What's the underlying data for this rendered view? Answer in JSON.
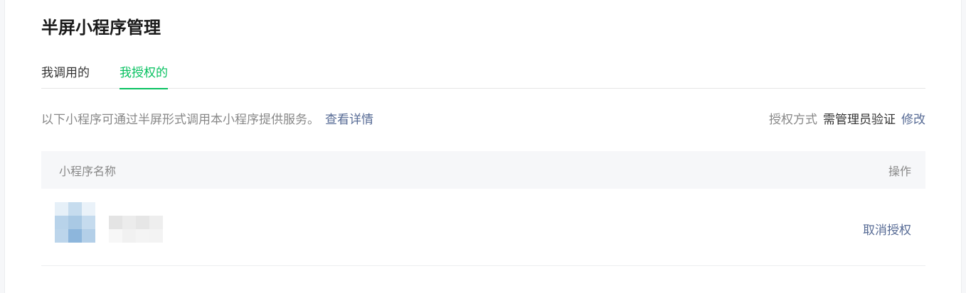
{
  "page": {
    "title": "半屏小程序管理"
  },
  "tabs": [
    {
      "label": "我调用的",
      "active": false
    },
    {
      "label": "我授权的",
      "active": true
    }
  ],
  "description": {
    "text": "以下小程序可通过半屏形式调用本小程序提供服务。",
    "link_label": "查看详情"
  },
  "auth": {
    "label": "授权方式",
    "value": "需管理员验证",
    "edit_label": "修改"
  },
  "table": {
    "columns": {
      "name": "小程序名称",
      "operation": "操作"
    },
    "rows": [
      {
        "name": "",
        "action_label": "取消授权"
      }
    ]
  },
  "colors": {
    "accent_green": "#07c160",
    "link_blue": "#576b95",
    "muted_text": "#888888",
    "header_bg": "#f6f7f9"
  }
}
